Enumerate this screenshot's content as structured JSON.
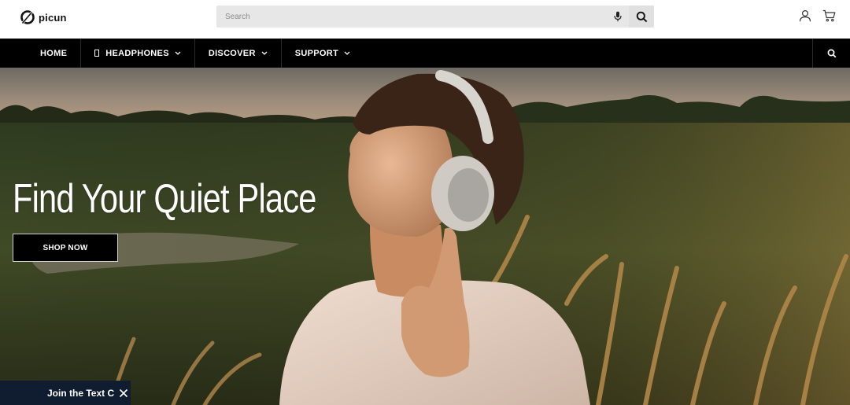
{
  "brand": {
    "name": "picun",
    "logo_icon": "picun-logo-icon"
  },
  "search": {
    "placeholder": "Search",
    "value": "",
    "mic_icon": "microphone-icon",
    "submit_icon": "search-icon"
  },
  "header_icons": [
    {
      "name": "account-icon"
    },
    {
      "name": "cart-icon"
    }
  ],
  "nav": {
    "items": [
      {
        "label": "HOME",
        "has_dropdown": false,
        "icon": null
      },
      {
        "label": "HEADPHONES",
        "has_dropdown": true,
        "icon": "box-icon"
      },
      {
        "label": "DISCOVER",
        "has_dropdown": true,
        "icon": null
      },
      {
        "label": "SUPPORT",
        "has_dropdown": true,
        "icon": null
      }
    ],
    "search_icon": "search-icon"
  },
  "hero": {
    "title": "Find Your Quiet Place",
    "cta_label": "SHOP NOW"
  },
  "popup_tab": {
    "label": "Join the Text C",
    "close_icon": "close-icon"
  },
  "colors": {
    "nav_background": "#000000",
    "search_background": "#e7e7e7",
    "cta_background": "#000000",
    "popup_background": "#101c30"
  }
}
